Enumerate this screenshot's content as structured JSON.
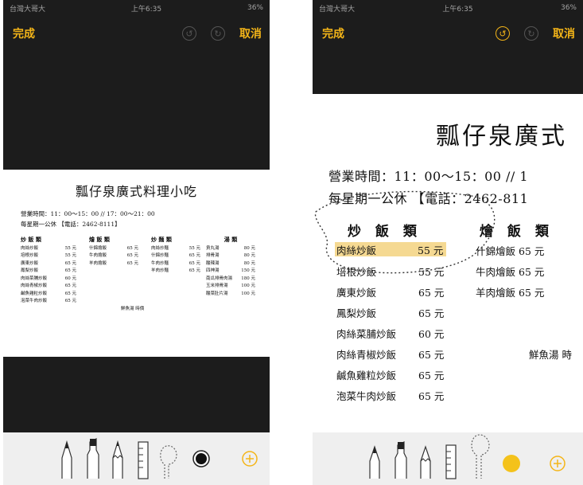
{
  "left": {
    "status": {
      "carrier": "台灣大哥大",
      "time": "上午6:35",
      "battery": "36%"
    },
    "topbar": {
      "done": "完成",
      "cancel": "取消",
      "undo_icon": "undo-icon",
      "redo_icon": "redo-icon"
    },
    "doc": {
      "title": "瓢仔泉廣式料理小吃",
      "hours": "營業時間：11：00～15：00 // 17：00～21：00",
      "closed": "每星期一公休 【電話：2462-8111】",
      "columns": [
        {
          "header": "炒 飯 類",
          "items": [
            {
              "name": "肉絲炒飯",
              "price": "55 元"
            },
            {
              "name": "培根炒飯",
              "price": "55 元"
            },
            {
              "name": "廣東炒飯",
              "price": "65 元"
            },
            {
              "name": "鳳梨炒飯",
              "price": "65 元"
            },
            {
              "name": "肉絲菜脯炒飯",
              "price": "60 元"
            },
            {
              "name": "肉絲青椒炒飯",
              "price": "65 元"
            },
            {
              "name": "鹹魚雞粒炒飯",
              "price": "65 元"
            },
            {
              "name": "泡菜牛肉炒飯",
              "price": "65 元"
            }
          ]
        },
        {
          "header": "燴 飯 類",
          "items": [
            {
              "name": "什錦燴飯",
              "price": "65 元"
            },
            {
              "name": "牛肉燴飯",
              "price": "65 元"
            },
            {
              "name": "羊肉燴飯",
              "price": "65 元"
            }
          ]
        },
        {
          "header": "炒 麵 類",
          "items": [
            {
              "name": "肉絲炒麵",
              "price": "55 元"
            },
            {
              "name": "什錦炒麵",
              "price": "65 元"
            },
            {
              "name": "牛肉炒麵",
              "price": "65 元"
            },
            {
              "name": "羊肉炒麵",
              "price": "65 元"
            }
          ]
        },
        {
          "header": "湯 類",
          "items": [
            {
              "name": "貢丸湯",
              "price": "80 元"
            },
            {
              "name": "排骨湯",
              "price": "80 元"
            },
            {
              "name": "酸辣湯",
              "price": "80 元"
            },
            {
              "name": "四神湯",
              "price": "150 元"
            },
            {
              "name": "南瓜排骨肉湯",
              "price": "180 元"
            },
            {
              "name": "玉米排骨湯",
              "price": "100 元"
            },
            {
              "name": "酸菜肚片湯",
              "price": "100 元"
            }
          ]
        }
      ],
      "note": "鮮魚湯 時價"
    },
    "tools": [
      "pen-icon",
      "marker-icon",
      "pencil-icon",
      "ruler-icon",
      "lasso-icon",
      "color-black-icon",
      "add-icon"
    ]
  },
  "right": {
    "status": {
      "carrier": "台灣大哥大",
      "time": "上午6:35",
      "battery": "36%"
    },
    "topbar": {
      "done": "完成",
      "cancel": "取消",
      "undo_icon": "undo-icon",
      "redo_icon": "redo-icon"
    },
    "doc": {
      "title": "瓢仔泉廣式",
      "hours": "營業時間：11：00～15：00 // 1",
      "closed": "每星期一公休 【電話：2462-811",
      "col1_header": "炒 飯 類",
      "col2_header": "燴 飯 類",
      "col1_items": [
        {
          "name": "肉絲炒飯",
          "price": "55 元"
        },
        {
          "name": "培根炒飯",
          "price": "55 元"
        },
        {
          "name": "廣東炒飯",
          "price": "65 元"
        },
        {
          "name": "鳳梨炒飯",
          "price": "65 元"
        },
        {
          "name": "肉絲菜脯炒飯",
          "price": "60 元"
        },
        {
          "name": "肉絲青椒炒飯",
          "price": "65 元"
        },
        {
          "name": "鹹魚雞粒炒飯",
          "price": "65 元"
        },
        {
          "name": "泡菜牛肉炒飯",
          "price": "65 元"
        }
      ],
      "col2_items": [
        {
          "name": "什錦燴飯",
          "price": "65 元"
        },
        {
          "name": "牛肉燴飯",
          "price": "65 元"
        },
        {
          "name": "羊肉燴飯",
          "price": "65 元"
        }
      ],
      "note": "鮮魚湯 時"
    },
    "highlight_color": "#f2cc6e",
    "tools": [
      "pen-icon",
      "marker-icon",
      "pencil-icon",
      "ruler-icon",
      "lasso-icon",
      "color-yellow-icon",
      "add-icon"
    ]
  }
}
